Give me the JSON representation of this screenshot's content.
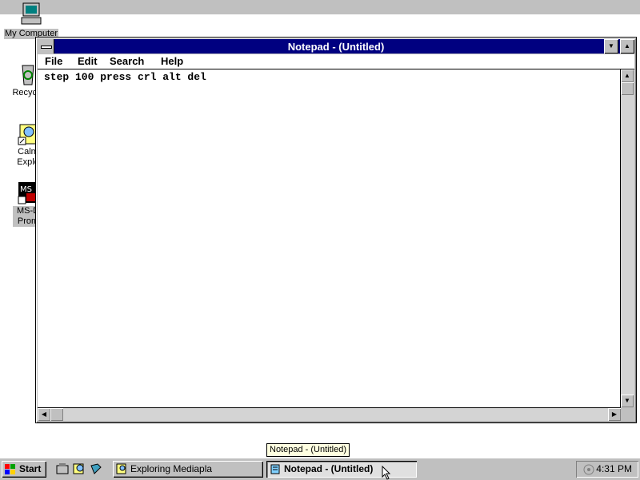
{
  "desktop": {
    "icons": [
      {
        "label": "My Computer",
        "icon": "computer-icon"
      },
      {
        "label": "Recycle",
        "icon": "recycle-bin-icon"
      },
      {
        "label": "Calm Explo",
        "icon": "explorer-shortcut-icon"
      },
      {
        "label": "MS-D Prom",
        "icon": "msdos-prompt-icon"
      }
    ]
  },
  "window": {
    "title": "Notepad - (Untitled)",
    "menu": [
      "File",
      "Edit",
      "Search",
      "Help"
    ],
    "content": "step 100 press crl alt del"
  },
  "tooltip": "Notepad - (Untitled)",
  "taskbar": {
    "start_label": "Start",
    "buttons": [
      {
        "label": "Exploring Mediapla",
        "icon": "explorer-icon"
      },
      {
        "label": "Notepad - (Untitled)",
        "icon": "notepad-icon",
        "active": true
      }
    ],
    "quicklaunch": [
      "desktop-icon",
      "search-icon",
      "book-icon"
    ],
    "clock": "4:31 PM"
  },
  "colors": {
    "titlebar": "#000080",
    "face": "#c0c0c0",
    "desktop": "#ffffff"
  }
}
